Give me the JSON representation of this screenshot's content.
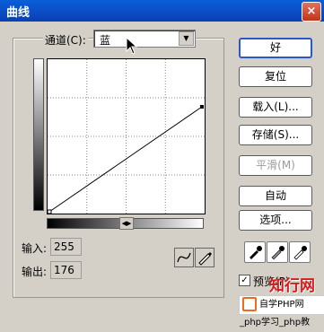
{
  "window": {
    "title": "曲线",
    "close": "×"
  },
  "channel": {
    "label": "通道(C):",
    "value": "蓝"
  },
  "curve": {
    "input_label": "输入:",
    "input_value": "255",
    "output_label": "输出:",
    "output_value": "176"
  },
  "buttons": {
    "ok": "好",
    "reset": "复位",
    "load": "载入(L)...",
    "save": "存储(S)...",
    "smooth": "平滑(M)",
    "auto": "自动",
    "options": "选项..."
  },
  "preview": {
    "label": "预览(P)",
    "checked": "✓"
  },
  "watermark": {
    "text": "知行网",
    "site": "自学PHP网_php学习_php教"
  }
}
